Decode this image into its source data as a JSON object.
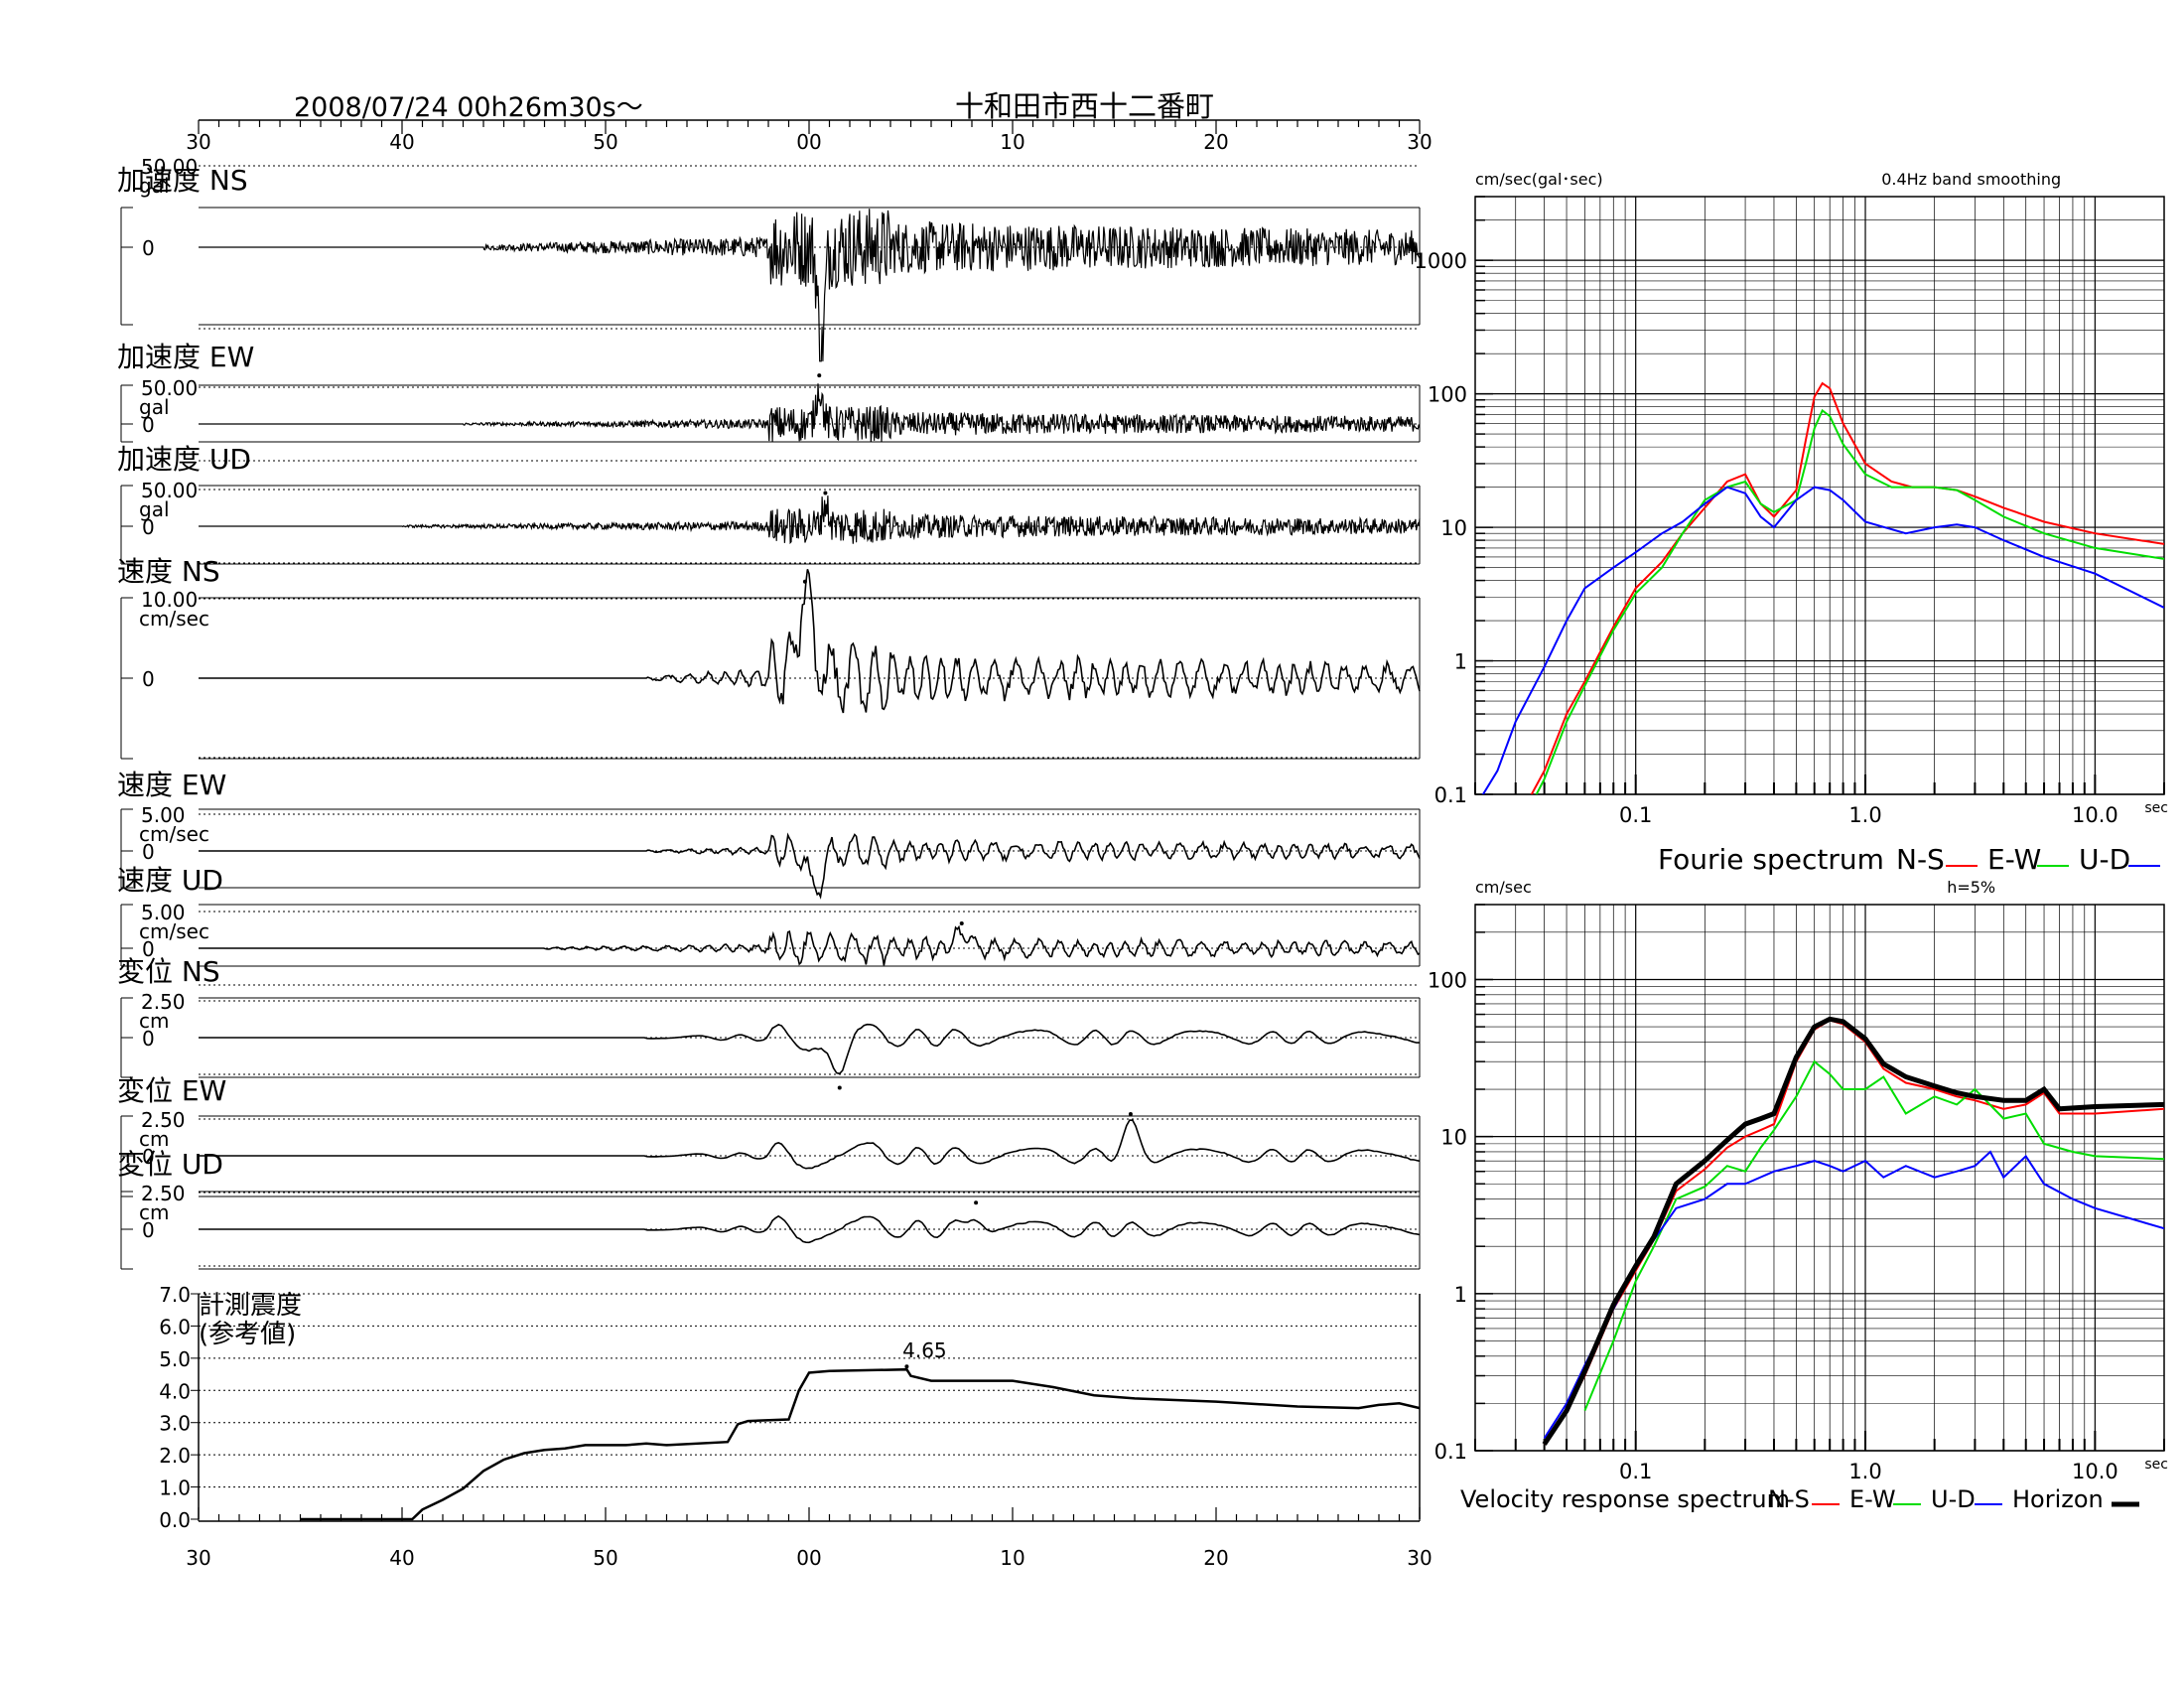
{
  "header": {
    "datetime": "2008/07/24  00h26m30s〜",
    "station": "十和田市西十二番町"
  },
  "time_axis": {
    "tick_labels": [
      "30",
      "40",
      "50",
      "00",
      "10",
      "20",
      "30"
    ]
  },
  "chart_data": [
    {
      "type": "line",
      "title": "",
      "xlabel": "",
      "ylabel": "",
      "x_unit": "seconds from 00h26m30s",
      "xlim": [
        0,
        60
      ],
      "traces": [
        {
          "id": "acc-ns",
          "label": "加速度 NS",
          "scale_value": "50.00",
          "unit": "gal",
          "zero_label": "0",
          "ylim": [
            -50,
            50
          ],
          "peak": 52,
          "peak_x": 30.6,
          "peak_sign": -1,
          "onset": 14,
          "mark": false,
          "rows": 2
        },
        {
          "id": "acc-ew",
          "label": "加速度 EW",
          "scale_value": "50.00",
          "unit": "gal",
          "zero_label": "0",
          "ylim": [
            -50,
            50
          ],
          "peak": 48,
          "peak_x": 30.5,
          "peak_sign": 1,
          "onset": 13,
          "mark": true,
          "rows": 1
        },
        {
          "id": "acc-ud",
          "label": "加速度 UD",
          "scale_value": "50.00",
          "unit": "gal",
          "zero_label": "0",
          "ylim": [
            -50,
            50
          ],
          "peak": 30,
          "peak_x": 30.8,
          "peak_sign": 1,
          "onset": 10,
          "mark": true,
          "rows": 1
        },
        {
          "id": "vel-ns",
          "label": "速度 NS",
          "scale_value": "10.00",
          "unit": "cm/sec",
          "zero_label": "0",
          "ylim": [
            -10,
            10
          ],
          "peak": 9.7,
          "peak_x": 29.8,
          "peak_sign": 1,
          "onset": 22,
          "mark": true,
          "rows": 2
        },
        {
          "id": "vel-ew",
          "label": "速度 EW",
          "scale_value": "5.00",
          "unit": "cm/sec",
          "zero_label": "0",
          "ylim": [
            -5,
            5
          ],
          "peak": 4.8,
          "peak_x": 30.3,
          "peak_sign": -1,
          "onset": 22,
          "mark": false,
          "rows": 1
        },
        {
          "id": "vel-ud",
          "label": "速度 UD",
          "scale_value": "5.00",
          "unit": "cm/sec",
          "zero_label": "0",
          "ylim": [
            -5,
            5
          ],
          "peak": 2.0,
          "peak_x": 37.5,
          "peak_sign": 1,
          "onset": 17,
          "mark": true,
          "rows": 1
        },
        {
          "id": "disp-ns",
          "label": "変位 NS",
          "scale_value": "2.50",
          "unit": "cm",
          "zero_label": "0",
          "ylim": [
            -2.5,
            2.5
          ],
          "peak": 2.5,
          "peak_x": 31.5,
          "peak_sign": -1,
          "onset": 22,
          "mark": true,
          "rows": 1
        },
        {
          "id": "disp-ew",
          "label": "変位 EW",
          "scale_value": "2.50",
          "unit": "cm",
          "zero_label": "0",
          "ylim": [
            -2.5,
            2.5
          ],
          "peak": 2.0,
          "peak_x": 45.8,
          "peak_sign": 1,
          "onset": 22,
          "mark": true,
          "rows": 1
        },
        {
          "id": "disp-ud",
          "label": "変位 UD",
          "scale_value": "2.50",
          "unit": "cm",
          "zero_label": "0",
          "ylim": [
            -2.5,
            2.5
          ],
          "peak": 1.1,
          "peak_x": 38.2,
          "peak_sign": 1,
          "onset": 22,
          "mark": true,
          "rows": 1
        }
      ]
    },
    {
      "type": "line",
      "title": "",
      "label_line1": "計測震度",
      "label_line2": "(参考値)",
      "ylim": [
        0,
        7
      ],
      "ytick_labels": [
        "7.0",
        "6.0",
        "5.0",
        "4.0",
        "3.0",
        "2.0",
        "1.0",
        "0.0"
      ],
      "peak_label": "4.65",
      "peak_x": 34.8,
      "x": [
        5,
        10.5,
        11,
        12,
        13,
        14,
        15,
        16,
        17,
        18,
        19,
        20,
        21,
        22,
        23,
        26,
        26.5,
        27,
        29,
        29.5,
        30,
        31,
        34.8,
        35,
        36,
        40,
        42,
        44,
        46,
        50,
        54,
        57,
        58,
        59,
        60
      ],
      "y": [
        0,
        0,
        0.3,
        0.6,
        0.95,
        1.5,
        1.85,
        2.05,
        2.15,
        2.2,
        2.3,
        2.3,
        2.3,
        2.35,
        2.3,
        2.4,
        2.95,
        3.05,
        3.1,
        4.0,
        4.55,
        4.6,
        4.65,
        4.45,
        4.3,
        4.3,
        4.1,
        3.85,
        3.75,
        3.65,
        3.5,
        3.45,
        3.55,
        3.6,
        3.45
      ]
    },
    {
      "type": "line",
      "title": "0.4Hz band smoothing",
      "ylabel": "cm/sec(gal･sec)",
      "xlabel": "sec",
      "xscale": "log",
      "yscale": "log",
      "xlim": [
        0.02,
        20
      ],
      "ylim": [
        0.1,
        3000
      ],
      "xtick_labels": [
        "0.1",
        "1.0",
        "10.0"
      ],
      "ytick_labels": [
        "1000",
        "100",
        "10",
        "1",
        "0.1"
      ],
      "legend_caption": "Fourie spectrum",
      "series": [
        {
          "name": "N-S",
          "color": "#ff0000",
          "width": 2,
          "x": [
            0.03,
            0.04,
            0.05,
            0.06,
            0.08,
            0.1,
            0.13,
            0.16,
            0.2,
            0.25,
            0.3,
            0.35,
            0.4,
            0.5,
            0.55,
            0.6,
            0.65,
            0.7,
            0.8,
            1.0,
            1.3,
            1.6,
            2.0,
            2.5,
            3.0,
            4.0,
            6.0,
            10.0,
            20.0
          ],
          "y": [
            0.06,
            0.15,
            0.4,
            0.7,
            1.8,
            3.5,
            5.5,
            9,
            14,
            22,
            25,
            15,
            12,
            19,
            45,
            95,
            120,
            110,
            60,
            30,
            22,
            20,
            20,
            19,
            17,
            14,
            11,
            9,
            7.5
          ]
        },
        {
          "name": "E-W",
          "color": "#00dd00",
          "width": 2,
          "x": [
            0.03,
            0.04,
            0.05,
            0.06,
            0.08,
            0.1,
            0.13,
            0.16,
            0.2,
            0.25,
            0.3,
            0.35,
            0.4,
            0.5,
            0.55,
            0.6,
            0.65,
            0.7,
            0.8,
            1.0,
            1.3,
            1.6,
            2.0,
            2.5,
            3.0,
            4.0,
            6.0,
            10.0,
            20.0
          ],
          "y": [
            0.05,
            0.13,
            0.35,
            0.65,
            1.7,
            3.2,
            5,
            9,
            16,
            20,
            22,
            15,
            13,
            16,
            30,
            55,
            75,
            68,
            42,
            25,
            20,
            20,
            20,
            19,
            16,
            12,
            9,
            7,
            5.8
          ]
        },
        {
          "name": "U-D",
          "color": "#0000ff",
          "width": 2,
          "x": [
            0.02,
            0.025,
            0.03,
            0.04,
            0.05,
            0.06,
            0.08,
            0.1,
            0.13,
            0.16,
            0.2,
            0.25,
            0.3,
            0.35,
            0.4,
            0.5,
            0.6,
            0.7,
            0.8,
            1.0,
            1.5,
            2.0,
            2.5,
            3.0,
            4.0,
            6.0,
            10.0,
            20.0
          ],
          "y": [
            0.08,
            0.15,
            0.35,
            0.9,
            2.0,
            3.5,
            5.0,
            6.5,
            9,
            11,
            15,
            20,
            18,
            12,
            10,
            16,
            20,
            19,
            16,
            11,
            9,
            10,
            10.5,
            10,
            8,
            6,
            4.5,
            2.5
          ]
        }
      ]
    },
    {
      "type": "line",
      "title": "h=5%",
      "ylabel": "cm/sec",
      "xlabel": "sec",
      "xscale": "log",
      "yscale": "log",
      "xlim": [
        0.02,
        20
      ],
      "ylim": [
        0.1,
        300
      ],
      "xtick_labels": [
        "0.1",
        "1.0",
        "10.0"
      ],
      "ytick_labels": [
        "100",
        "10",
        "1",
        "0.1"
      ],
      "legend_caption": "Velocity response spectrum",
      "series": [
        {
          "name": "N-S",
          "color": "#ff0000",
          "width": 2,
          "x": [
            0.04,
            0.05,
            0.06,
            0.08,
            0.1,
            0.12,
            0.15,
            0.2,
            0.25,
            0.3,
            0.35,
            0.4,
            0.5,
            0.6,
            0.7,
            0.8,
            1.0,
            1.2,
            1.5,
            2.0,
            2.5,
            3.0,
            4.0,
            5.0,
            6.0,
            7.0,
            10.0,
            20.0
          ],
          "y": [
            0.11,
            0.18,
            0.3,
            0.8,
            1.4,
            2.2,
            4.5,
            6.2,
            8.5,
            10,
            11,
            12,
            30,
            48,
            55,
            52,
            40,
            27,
            22,
            20,
            18,
            17,
            15,
            16,
            19,
            14,
            14,
            15
          ]
        },
        {
          "name": "E-W",
          "color": "#00dd00",
          "width": 2,
          "x": [
            0.06,
            0.08,
            0.1,
            0.12,
            0.15,
            0.2,
            0.25,
            0.3,
            0.35,
            0.4,
            0.5,
            0.6,
            0.7,
            0.8,
            1.0,
            1.2,
            1.5,
            2.0,
            2.5,
            3.0,
            4.0,
            5.0,
            6.0,
            8.0,
            10.0,
            20.0
          ],
          "y": [
            0.18,
            0.5,
            1.2,
            2.0,
            4.0,
            4.8,
            6.5,
            6.0,
            8.5,
            11,
            18,
            30,
            25,
            20,
            20,
            24,
            14,
            18,
            16,
            20,
            13,
            14,
            9,
            8,
            7.5,
            7.2
          ]
        },
        {
          "name": "U-D",
          "color": "#0000ff",
          "width": 2,
          "x": [
            0.04,
            0.05,
            0.06,
            0.08,
            0.1,
            0.12,
            0.15,
            0.2,
            0.25,
            0.3,
            0.4,
            0.5,
            0.6,
            0.7,
            0.8,
            1.0,
            1.2,
            1.5,
            2.0,
            2.5,
            3.0,
            3.5,
            4.0,
            5.0,
            6.0,
            8.0,
            10.0,
            20.0
          ],
          "y": [
            0.12,
            0.2,
            0.35,
            0.8,
            1.5,
            2.2,
            3.5,
            4.0,
            5.0,
            5.0,
            6.0,
            6.5,
            7.0,
            6.5,
            6.0,
            7.0,
            5.5,
            6.5,
            5.5,
            6.0,
            6.5,
            8.0,
            5.5,
            7.5,
            5.0,
            4.0,
            3.5,
            2.6
          ]
        },
        {
          "name": "Horizon",
          "color": "#000000",
          "width": 5,
          "x": [
            0.04,
            0.05,
            0.06,
            0.08,
            0.1,
            0.12,
            0.15,
            0.2,
            0.25,
            0.3,
            0.35,
            0.4,
            0.5,
            0.6,
            0.7,
            0.8,
            1.0,
            1.2,
            1.5,
            2.0,
            2.5,
            3.0,
            4.0,
            5.0,
            6.0,
            7.0,
            10.0,
            20.0
          ],
          "y": [
            0.11,
            0.18,
            0.32,
            0.85,
            1.5,
            2.3,
            5.0,
            7.0,
            9.5,
            12,
            13,
            14,
            32,
            50,
            56,
            54,
            42,
            29,
            24,
            21,
            19,
            18,
            17,
            17,
            20,
            15,
            15.5,
            16
          ]
        }
      ]
    }
  ]
}
